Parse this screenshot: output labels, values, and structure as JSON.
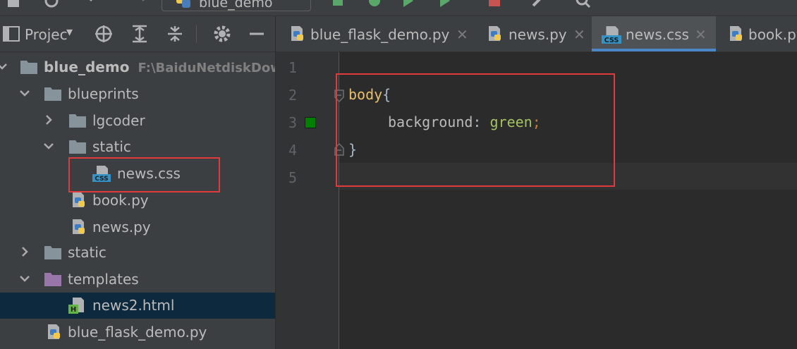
{
  "toolbar": {
    "run_config": "blue_demo"
  },
  "project_panel": {
    "title": "Project",
    "tree": [
      {
        "label": "blue_demo",
        "path": "F:\\BaiduNetdiskDow",
        "type": "folder",
        "expanded": true,
        "depth": 0,
        "bold": true
      },
      {
        "label": "blueprints",
        "type": "folder",
        "expanded": true,
        "depth": 1
      },
      {
        "label": "lgcoder",
        "type": "folder",
        "expanded": false,
        "depth": 2
      },
      {
        "label": "static",
        "type": "folder",
        "expanded": true,
        "depth": 2
      },
      {
        "label": "news.css",
        "type": "css",
        "depth": 3,
        "highlighted": true
      },
      {
        "label": "book.py",
        "type": "python",
        "depth": 2
      },
      {
        "label": "news.py",
        "type": "python",
        "depth": 2
      },
      {
        "label": "static",
        "type": "folder",
        "expanded": false,
        "depth": 1
      },
      {
        "label": "templates",
        "type": "template-folder",
        "expanded": true,
        "depth": 1
      },
      {
        "label": "news2.html",
        "type": "html",
        "depth": 2,
        "selected": true
      },
      {
        "label": "blue_flask_demo.py",
        "type": "python",
        "depth": 1
      }
    ]
  },
  "tabs": [
    {
      "label": "blue_flask_demo.py",
      "type": "python",
      "active": false
    },
    {
      "label": "news.py",
      "type": "python",
      "active": false
    },
    {
      "label": "news.css",
      "type": "css",
      "active": true
    },
    {
      "label": "book.py",
      "type": "python",
      "active": false
    }
  ],
  "editor": {
    "line_numbers": [
      "1",
      "2",
      "3",
      "4",
      "5"
    ],
    "code": {
      "selector": "body",
      "open_brace": "{",
      "property": "background",
      "colon": ":",
      "value": "green",
      "semicolon": ";",
      "close_brace": "}"
    },
    "color_swatch": "#008000"
  },
  "colors": {
    "accent": "#4a88c7",
    "highlight_box": "#e0393e",
    "selected_row": "#0d293e"
  }
}
